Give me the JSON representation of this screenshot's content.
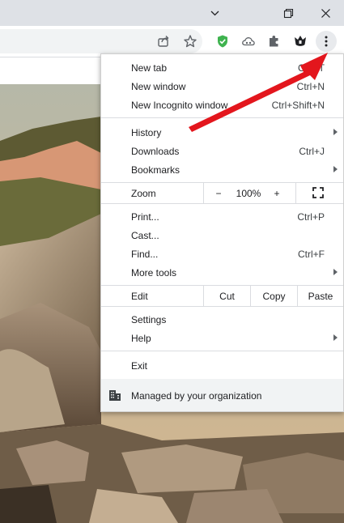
{
  "window": {
    "buttons": [
      "minimize",
      "restore",
      "close"
    ],
    "icons": [
      "chevron-down-icon",
      "restore-icon",
      "close-icon"
    ]
  },
  "toolbar": {
    "icons": [
      "share-icon",
      "star-icon",
      "shield-check-icon",
      "cloud-icon",
      "puzzle-icon",
      "extension-badge-icon",
      "kebab-menu-icon"
    ],
    "accent_shield": "#3fb34f"
  },
  "menu": {
    "new_tab": {
      "label": "New tab",
      "shortcut": "Ctrl+T"
    },
    "new_window": {
      "label": "New window",
      "shortcut": "Ctrl+N"
    },
    "new_incognito": {
      "label": "New Incognito window",
      "shortcut": "Ctrl+Shift+N"
    },
    "history": {
      "label": "History"
    },
    "downloads": {
      "label": "Downloads",
      "shortcut": "Ctrl+J"
    },
    "bookmarks": {
      "label": "Bookmarks"
    },
    "zoom": {
      "label": "Zoom",
      "minus": "−",
      "value": "100%",
      "plus": "+"
    },
    "print": {
      "label": "Print...",
      "shortcut": "Ctrl+P"
    },
    "cast": {
      "label": "Cast..."
    },
    "find": {
      "label": "Find...",
      "shortcut": "Ctrl+F"
    },
    "more_tools": {
      "label": "More tools"
    },
    "edit": {
      "label": "Edit",
      "cut": "Cut",
      "copy": "Copy",
      "paste": "Paste"
    },
    "settings": {
      "label": "Settings"
    },
    "help": {
      "label": "Help"
    },
    "exit": {
      "label": "Exit"
    },
    "managed": {
      "label": "Managed by your organization"
    }
  },
  "annotation": {
    "arrow_color": "#e3161d"
  }
}
